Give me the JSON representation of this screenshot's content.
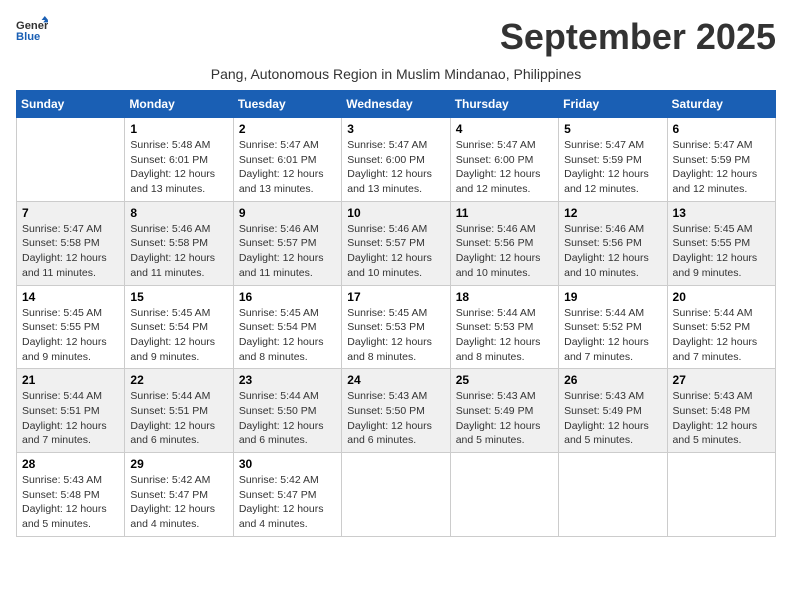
{
  "app": {
    "logo_line1": "General",
    "logo_line2": "Blue"
  },
  "header": {
    "month_year": "September 2025",
    "location": "Pang, Autonomous Region in Muslim Mindanao, Philippines"
  },
  "days_of_week": [
    "Sunday",
    "Monday",
    "Tuesday",
    "Wednesday",
    "Thursday",
    "Friday",
    "Saturday"
  ],
  "weeks": [
    {
      "cells": [
        {
          "day": "",
          "info": ""
        },
        {
          "day": "1",
          "info": "Sunrise: 5:48 AM\nSunset: 6:01 PM\nDaylight: 12 hours\nand 13 minutes."
        },
        {
          "day": "2",
          "info": "Sunrise: 5:47 AM\nSunset: 6:01 PM\nDaylight: 12 hours\nand 13 minutes."
        },
        {
          "day": "3",
          "info": "Sunrise: 5:47 AM\nSunset: 6:00 PM\nDaylight: 12 hours\nand 13 minutes."
        },
        {
          "day": "4",
          "info": "Sunrise: 5:47 AM\nSunset: 6:00 PM\nDaylight: 12 hours\nand 12 minutes."
        },
        {
          "day": "5",
          "info": "Sunrise: 5:47 AM\nSunset: 5:59 PM\nDaylight: 12 hours\nand 12 minutes."
        },
        {
          "day": "6",
          "info": "Sunrise: 5:47 AM\nSunset: 5:59 PM\nDaylight: 12 hours\nand 12 minutes."
        }
      ]
    },
    {
      "cells": [
        {
          "day": "7",
          "info": "Sunrise: 5:47 AM\nSunset: 5:58 PM\nDaylight: 12 hours\nand 11 minutes."
        },
        {
          "day": "8",
          "info": "Sunrise: 5:46 AM\nSunset: 5:58 PM\nDaylight: 12 hours\nand 11 minutes."
        },
        {
          "day": "9",
          "info": "Sunrise: 5:46 AM\nSunset: 5:57 PM\nDaylight: 12 hours\nand 11 minutes."
        },
        {
          "day": "10",
          "info": "Sunrise: 5:46 AM\nSunset: 5:57 PM\nDaylight: 12 hours\nand 10 minutes."
        },
        {
          "day": "11",
          "info": "Sunrise: 5:46 AM\nSunset: 5:56 PM\nDaylight: 12 hours\nand 10 minutes."
        },
        {
          "day": "12",
          "info": "Sunrise: 5:46 AM\nSunset: 5:56 PM\nDaylight: 12 hours\nand 10 minutes."
        },
        {
          "day": "13",
          "info": "Sunrise: 5:45 AM\nSunset: 5:55 PM\nDaylight: 12 hours\nand 9 minutes."
        }
      ]
    },
    {
      "cells": [
        {
          "day": "14",
          "info": "Sunrise: 5:45 AM\nSunset: 5:55 PM\nDaylight: 12 hours\nand 9 minutes."
        },
        {
          "day": "15",
          "info": "Sunrise: 5:45 AM\nSunset: 5:54 PM\nDaylight: 12 hours\nand 9 minutes."
        },
        {
          "day": "16",
          "info": "Sunrise: 5:45 AM\nSunset: 5:54 PM\nDaylight: 12 hours\nand 8 minutes."
        },
        {
          "day": "17",
          "info": "Sunrise: 5:45 AM\nSunset: 5:53 PM\nDaylight: 12 hours\nand 8 minutes."
        },
        {
          "day": "18",
          "info": "Sunrise: 5:44 AM\nSunset: 5:53 PM\nDaylight: 12 hours\nand 8 minutes."
        },
        {
          "day": "19",
          "info": "Sunrise: 5:44 AM\nSunset: 5:52 PM\nDaylight: 12 hours\nand 7 minutes."
        },
        {
          "day": "20",
          "info": "Sunrise: 5:44 AM\nSunset: 5:52 PM\nDaylight: 12 hours\nand 7 minutes."
        }
      ]
    },
    {
      "cells": [
        {
          "day": "21",
          "info": "Sunrise: 5:44 AM\nSunset: 5:51 PM\nDaylight: 12 hours\nand 7 minutes."
        },
        {
          "day": "22",
          "info": "Sunrise: 5:44 AM\nSunset: 5:51 PM\nDaylight: 12 hours\nand 6 minutes."
        },
        {
          "day": "23",
          "info": "Sunrise: 5:44 AM\nSunset: 5:50 PM\nDaylight: 12 hours\nand 6 minutes."
        },
        {
          "day": "24",
          "info": "Sunrise: 5:43 AM\nSunset: 5:50 PM\nDaylight: 12 hours\nand 6 minutes."
        },
        {
          "day": "25",
          "info": "Sunrise: 5:43 AM\nSunset: 5:49 PM\nDaylight: 12 hours\nand 5 minutes."
        },
        {
          "day": "26",
          "info": "Sunrise: 5:43 AM\nSunset: 5:49 PM\nDaylight: 12 hours\nand 5 minutes."
        },
        {
          "day": "27",
          "info": "Sunrise: 5:43 AM\nSunset: 5:48 PM\nDaylight: 12 hours\nand 5 minutes."
        }
      ]
    },
    {
      "cells": [
        {
          "day": "28",
          "info": "Sunrise: 5:43 AM\nSunset: 5:48 PM\nDaylight: 12 hours\nand 5 minutes."
        },
        {
          "day": "29",
          "info": "Sunrise: 5:42 AM\nSunset: 5:47 PM\nDaylight: 12 hours\nand 4 minutes."
        },
        {
          "day": "30",
          "info": "Sunrise: 5:42 AM\nSunset: 5:47 PM\nDaylight: 12 hours\nand 4 minutes."
        },
        {
          "day": "",
          "info": ""
        },
        {
          "day": "",
          "info": ""
        },
        {
          "day": "",
          "info": ""
        },
        {
          "day": "",
          "info": ""
        }
      ]
    }
  ]
}
